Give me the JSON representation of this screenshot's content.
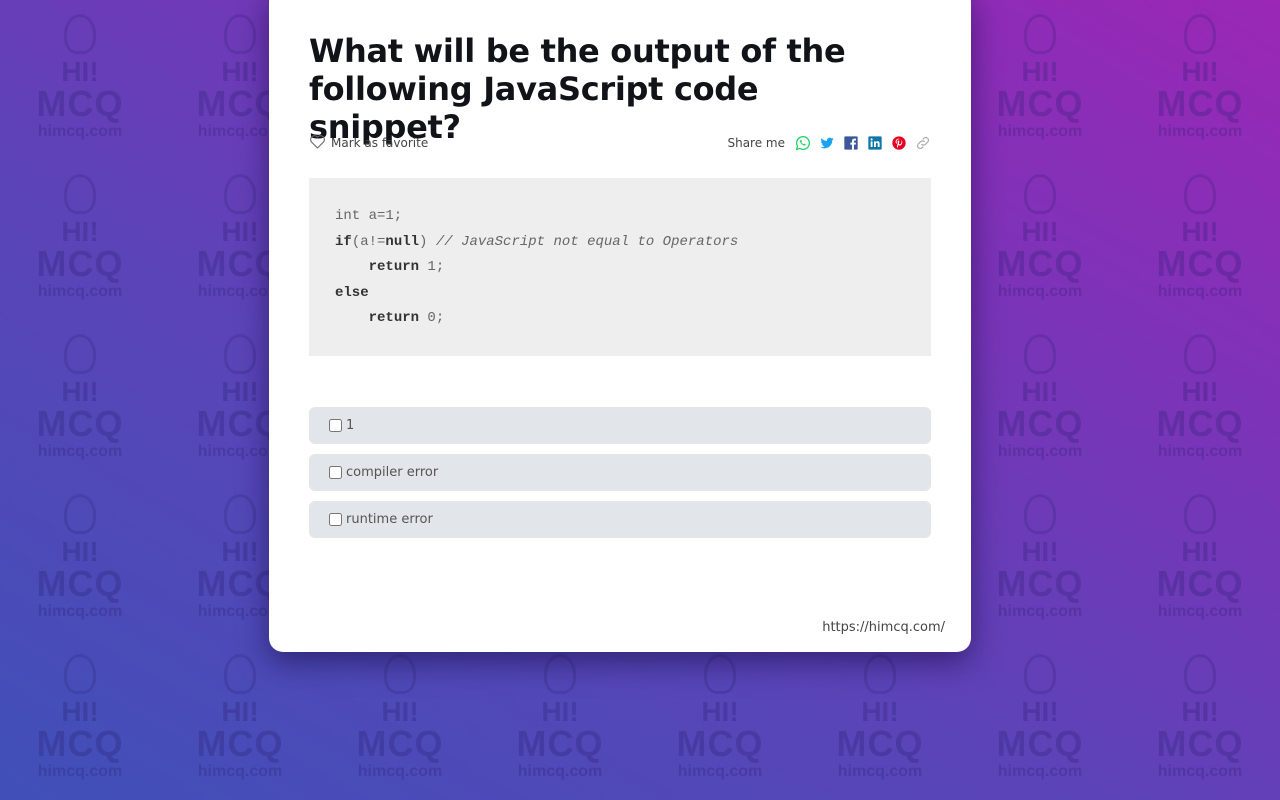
{
  "background": {
    "watermark": {
      "hi": "HI!",
      "mcq": "MCQ",
      "url": "himcq.com"
    },
    "gradient_colors": [
      "#4050b8",
      "#9b27b6"
    ]
  },
  "question": {
    "title": "What will be the output of the following JavaScript code snippet?"
  },
  "meta": {
    "favorite_label": "Mark as favorite",
    "share_label": "Share me",
    "share_icons": [
      {
        "name": "whatsapp-icon",
        "color": "#25d366"
      },
      {
        "name": "twitter-icon",
        "color": "#1da1f2"
      },
      {
        "name": "facebook-icon",
        "color": "#3b5998"
      },
      {
        "name": "linkedin-icon",
        "color": "#0e76a8"
      },
      {
        "name": "pinterest-icon",
        "color": "#e60023"
      },
      {
        "name": "link-icon",
        "color": "#aaaaaa"
      }
    ]
  },
  "code": {
    "lines": [
      {
        "parts": [
          {
            "t": "int a=1;",
            "c": "plain"
          }
        ]
      },
      {
        "parts": [
          {
            "t": "if",
            "c": "kw"
          },
          {
            "t": "(a!=",
            "c": "plain"
          },
          {
            "t": "null",
            "c": "kw"
          },
          {
            "t": ") ",
            "c": "plain"
          },
          {
            "t": "// JavaScript not equal to Operators",
            "c": "cm"
          }
        ]
      },
      {
        "parts": [
          {
            "t": "    ",
            "c": "plain"
          },
          {
            "t": "return",
            "c": "kw"
          },
          {
            "t": " 1;",
            "c": "plain"
          }
        ]
      },
      {
        "parts": [
          {
            "t": "else",
            "c": "kw"
          }
        ]
      },
      {
        "parts": [
          {
            "t": "    ",
            "c": "plain"
          },
          {
            "t": "return",
            "c": "kw"
          },
          {
            "t": " 0;",
            "c": "plain"
          }
        ]
      }
    ]
  },
  "options": [
    {
      "label": "1",
      "checked": false
    },
    {
      "label": "compiler error",
      "checked": false
    },
    {
      "label": "runtime error",
      "checked": false
    }
  ],
  "footer": {
    "url": "https://himcq.com/"
  }
}
